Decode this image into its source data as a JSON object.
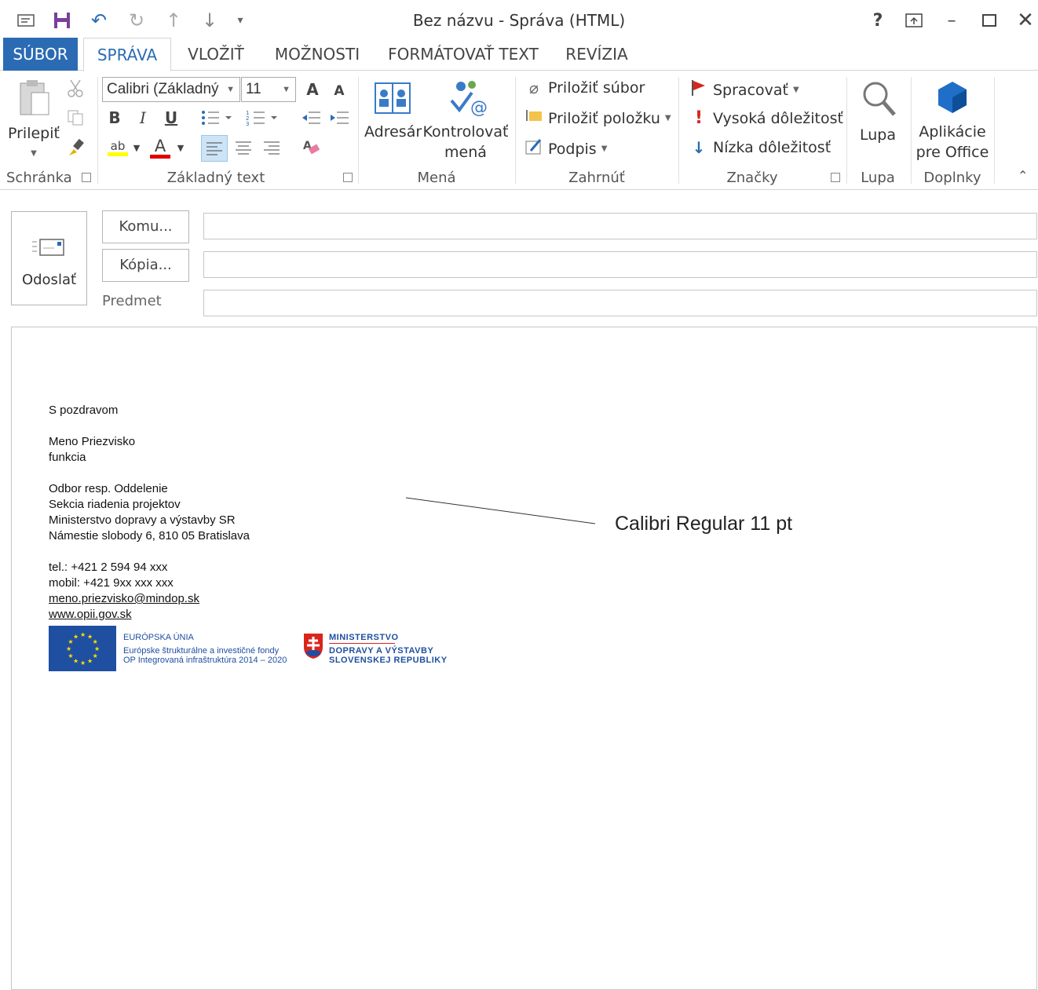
{
  "window": {
    "title": "Bez názvu - Správa (HTML)",
    "help": "?",
    "quick_access": [
      "message-icon",
      "save-icon",
      "undo-icon",
      "redo-icon",
      "up-arrow-icon",
      "down-arrow-icon",
      "customize-icon"
    ]
  },
  "tabs": [
    "SÚBOR",
    "SPRÁVA",
    "VLOŽIŤ",
    "MOŽNOSTI",
    "FORMÁTOVAŤ TEXT",
    "REVÍZIA"
  ],
  "ribbon": {
    "clipboard": {
      "paste": "Prilepiť",
      "group": "Schránka"
    },
    "basic_text": {
      "font": "Calibri (Základný",
      "size": "11",
      "bold": "B",
      "italic": "I",
      "underline": "U",
      "grow": "A",
      "shrink": "A",
      "highlight": "ab",
      "font_color": "A",
      "group": "Základný text"
    },
    "names": {
      "address_book": "Adresár",
      "check_names_1": "Kontrolovať",
      "check_names_2": "mená",
      "group": "Mená"
    },
    "include": {
      "attach_file": "Priložiť súbor",
      "attach_item": "Priložiť položku",
      "signature": "Podpis",
      "group": "Zahrnúť"
    },
    "tags": {
      "follow_up": "Spracovať",
      "high": "Vysoká dôležitosť",
      "low": "Nízka dôležitosť",
      "group": "Značky"
    },
    "zoom": {
      "label": "Lupa",
      "group": "Lupa"
    },
    "addins": {
      "label_1": "Aplikácie",
      "label_2": "pre Office",
      "group": "Doplnky"
    }
  },
  "header": {
    "send": "Odoslať",
    "to": "Komu...",
    "cc": "Kópia...",
    "subject": "Predmet",
    "to_value": "",
    "cc_value": "",
    "subject_value": ""
  },
  "signature": {
    "greeting": "S pozdravom",
    "name": "Meno Priezvisko",
    "role": "funkcia",
    "dept": "Odbor resp. Oddelenie",
    "section": "Sekcia riadenia projektov",
    "ministry": "Ministerstvo dopravy a výstavby SR",
    "address": "Námestie slobody 6, 810 05 Bratislava",
    "tel": "tel.: +421 2 594 94 xxx",
    "mobile": "mobil: +421 9xx xxx xxx",
    "email": "meno.priezvisko@mindop.sk",
    "web": "www.opii.gov.sk",
    "eu_title": "EURÓPSKA ÚNIA",
    "eu_line1": "Európske štrukturálne a investičné fondy",
    "eu_line2": "OP Integrovaná infraštruktúra 2014 – 2020",
    "min_line1": "MINISTERSTVO",
    "min_line2": "DOPRAVY A VÝSTAVBY",
    "min_line3": "SLOVENSKEJ REPUBLIKY"
  },
  "annotation": "Calibri Regular 11 pt",
  "colors": {
    "accent": "#2b6bb3",
    "eu_blue": "#1f4fa0",
    "highlight": "#ffff00",
    "font_red": "#e00000",
    "flag_red": "#d9251c"
  }
}
